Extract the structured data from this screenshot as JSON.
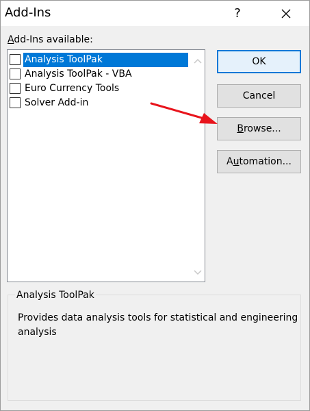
{
  "window": {
    "title": "Add-Ins",
    "help_glyph": "?",
    "close_icon": "close-icon"
  },
  "available": {
    "label_prefix": "A",
    "label_rest": "dd-Ins available:",
    "items": [
      {
        "label": "Analysis ToolPak",
        "checked": false,
        "selected": true
      },
      {
        "label": "Analysis ToolPak - VBA",
        "checked": false,
        "selected": false
      },
      {
        "label": "Euro Currency Tools",
        "checked": false,
        "selected": false
      },
      {
        "label": "Solver Add-in",
        "checked": false,
        "selected": false
      }
    ]
  },
  "buttons": {
    "ok": "OK",
    "cancel": "Cancel",
    "browse_prefix": "B",
    "browse_rest": "rowse...",
    "automation_prefix": "A",
    "automation_underline": "u",
    "automation_rest": "tomation..."
  },
  "details": {
    "title": "Analysis ToolPak",
    "description": "Provides data analysis tools for statistical and engineering analysis"
  },
  "colors": {
    "selection": "#0078d7",
    "arrow": "#e8141c"
  }
}
